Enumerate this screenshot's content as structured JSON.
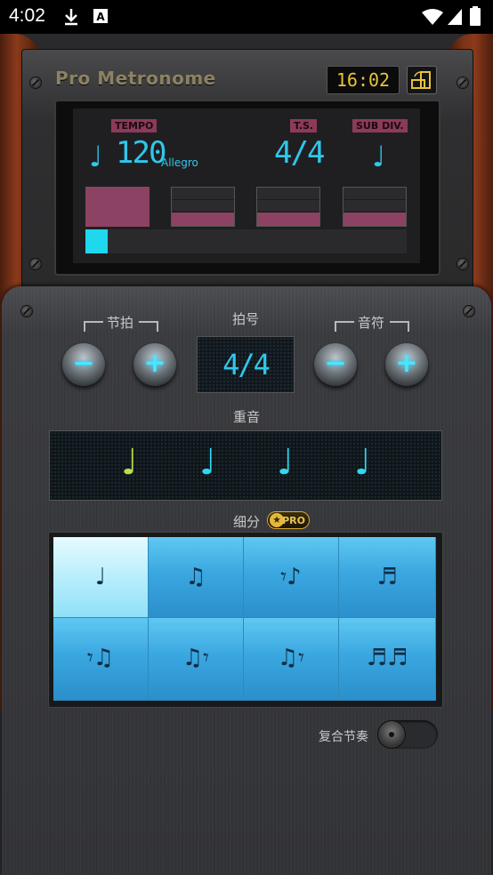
{
  "status_bar": {
    "time": "4:02"
  },
  "header": {
    "brand": "Pro Metronome",
    "clock": "16:02"
  },
  "lcd": {
    "tempo_label": "TEMPO",
    "ts_label": "T.S.",
    "subdiv_label": "SUB DIV.",
    "tempo_value": "120",
    "tempo_name": "Allegro",
    "time_signature": "4/4",
    "beat_note": "♩",
    "subdiv_note": "♩",
    "progress": 0.07
  },
  "controls": {
    "beat_label": "节拍",
    "time_sig_label": "拍号",
    "note_label": "音符",
    "time_sig_value": "4/4",
    "minus": "−",
    "plus": "+",
    "accent_label": "重音",
    "accent_notes": [
      "♩",
      "♩",
      "♩",
      "♩"
    ],
    "subdivision_label": "细分",
    "pro_badge": "PRO",
    "polyrhythm_label": "复合节奏"
  },
  "subdivisions": [
    "♩",
    "♫",
    "𝄾♪",
    "♬",
    "𝄾♫",
    "♫𝄾",
    "♫𝄾",
    "♬♬"
  ],
  "colors": {
    "lcd_cyan": "#2fc8ea",
    "beat_magenta": "#8c4262",
    "accent_active": "#b8e04a",
    "grid_blue": "#3aa7e0"
  }
}
